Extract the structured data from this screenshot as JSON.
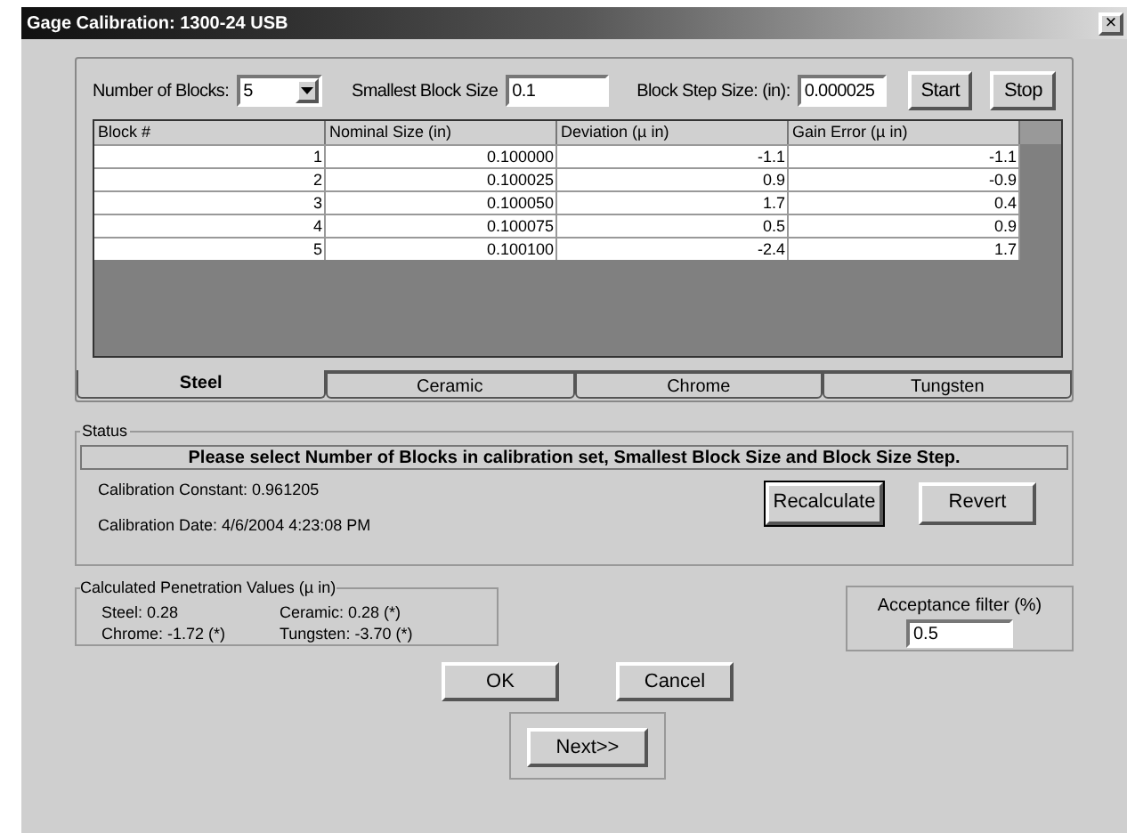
{
  "window": {
    "title": "Gage Calibration: 1300-24 USB",
    "close": "×"
  },
  "controls": {
    "blocks_label": "Number of Blocks:",
    "blocks_value": "5",
    "smallest_label": "Smallest Block Size",
    "smallest_value": "0.1",
    "step_label": "Block Step Size: (in):",
    "step_value": "0.000025",
    "buttons": [
      "Start",
      "Stop"
    ]
  },
  "table": {
    "columns": [
      "Block #",
      "Nominal Size (in)",
      "Deviation (µ in)",
      "Gain Error (µ in)"
    ],
    "rows": [
      [
        "1",
        "0.100000",
        "-1.1",
        "-1.1"
      ],
      [
        "2",
        "0.100025",
        "0.9",
        "-0.9"
      ],
      [
        "3",
        "0.100050",
        "1.7",
        "0.4"
      ],
      [
        "4",
        "0.100075",
        "0.5",
        "0.9"
      ],
      [
        "5",
        "0.100100",
        "-2.4",
        "1.7"
      ]
    ]
  },
  "tabs": [
    {
      "label": "Steel",
      "selected": true
    },
    {
      "label": "Ceramic",
      "selected": false
    },
    {
      "label": "Chrome",
      "selected": false
    },
    {
      "label": "Tungsten",
      "selected": false
    }
  ],
  "status": {
    "title": "Status",
    "message": "Please select Number of Blocks in calibration set, Smallest Block Size and Block Size Step.",
    "constant": "Calibration Constant: 0.961205",
    "date": "Calibration Date: 4/6/2004 4:23:08 PM",
    "buttons": [
      "Recalculate",
      "Revert"
    ]
  },
  "penetration": {
    "title": "Calculated Penetration Values (µ in)",
    "values": [
      "Steel: 0.28",
      "Ceramic: 0.28 (*)",
      "Chrome: -1.72 (*)",
      "Tungsten: -3.70 (*)"
    ]
  },
  "acceptance": {
    "label": "Acceptance filter (%)",
    "value": "0.5"
  },
  "buttons": [
    "OK",
    "Cancel"
  ],
  "next": "Next>>"
}
